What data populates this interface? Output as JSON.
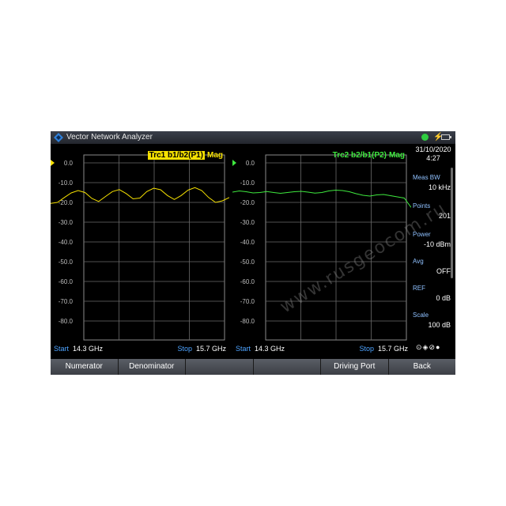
{
  "window": {
    "title": "Vector Network Analyzer",
    "logo_icon": "rs-diamond-icon"
  },
  "status": {
    "power_dot_color": "#2ecc40",
    "plug_icon": "lightning-plug-icon",
    "battery_icon": "battery-icon"
  },
  "traces": [
    {
      "name": "Trc1 b1/b2(P1)",
      "format": "Mag",
      "color": "#f5e000",
      "start_label": "Start",
      "start_value": "14.3 GHz",
      "stop_label": "Stop",
      "stop_value": "15.7 GHz",
      "y_ticks": [
        "0.0",
        "-10.0",
        "-20.0",
        "-30.0",
        "-40.0",
        "-50.0",
        "-60.0",
        "-70.0",
        "-80.0"
      ],
      "trace_db": [
        -20.5,
        -20.0,
        -17.5,
        -15.2,
        -14.0,
        -15.0,
        -18.0,
        -19.5,
        -17.0,
        -14.5,
        -13.5,
        -15.5,
        -18.2,
        -17.8,
        -14.5,
        -12.8,
        -13.6,
        -16.5,
        -18.5,
        -16.5,
        -13.8,
        -12.5,
        -14.0,
        -17.5,
        -20.0,
        -19.2,
        -17.5
      ]
    },
    {
      "name": "Trc2 b2/b1(P2)",
      "format": "Mag",
      "color": "#3ee83e",
      "start_label": "Start",
      "start_value": "14.3 GHz",
      "stop_label": "Stop",
      "stop_value": "15.7 GHz",
      "y_ticks": [
        "0.0",
        "-10.0",
        "-20.0",
        "-30.0",
        "-40.0",
        "-50.0",
        "-60.0",
        "-70.0",
        "-80.0"
      ],
      "trace_db": [
        -14.8,
        -14.2,
        -14.6,
        -15.2,
        -15.0,
        -14.5,
        -15.0,
        -15.4,
        -15.0,
        -14.6,
        -14.4,
        -14.8,
        -15.3,
        -15.0,
        -14.2,
        -13.8,
        -14.0,
        -14.6,
        -15.6,
        -16.4,
        -16.8,
        -16.2,
        -16.0,
        -16.6,
        -17.2,
        -17.8,
        -22.5
      ]
    }
  ],
  "sidebar": {
    "date": "31/10/2020",
    "time": "4:27",
    "items": [
      {
        "name": "Meas BW",
        "value": "10 kHz"
      },
      {
        "name": "Points",
        "value": "201"
      },
      {
        "name": "Power",
        "value": "-10 dBm"
      },
      {
        "name": "Avg",
        "value": "OFF"
      },
      {
        "name": "REF",
        "value": "0 dB"
      },
      {
        "name": "Scale",
        "value": "100 dB"
      }
    ],
    "connector_icon": "port-connection-icon"
  },
  "softkeys": [
    "Numerator",
    "Denominator",
    "",
    "",
    "Driving Port",
    "Back"
  ],
  "watermark": "www.rusgeocom.ru"
}
